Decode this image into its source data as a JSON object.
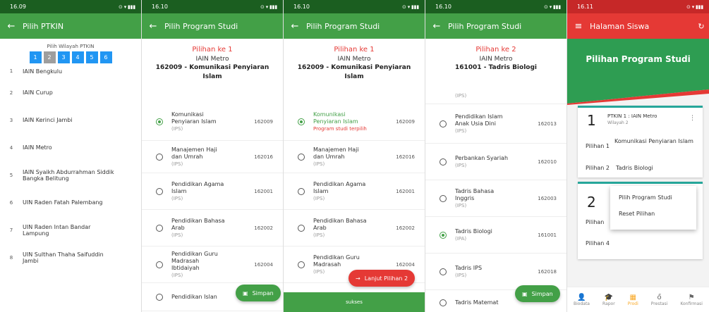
{
  "s1": {
    "time": "16.09",
    "title": "Pilih PTKIN",
    "wilayah_label": "Pilih Wilayah PTKIN",
    "pages": [
      "1",
      "2",
      "3",
      "4",
      "5",
      "6"
    ],
    "items": [
      {
        "n": "1",
        "name": "IAIN Bengkulu"
      },
      {
        "n": "2",
        "name": "IAIN Curup"
      },
      {
        "n": "3",
        "name": "IAIN Kerinci Jambi"
      },
      {
        "n": "4",
        "name": "IAIN Metro"
      },
      {
        "n": "5",
        "name": "IAIN Syaikh Abdurrahman Siddik Bangka Belitung"
      },
      {
        "n": "6",
        "name": "UIN Raden Fatah Palembang"
      },
      {
        "n": "7",
        "name": "UIN Raden Intan Bandar Lampung"
      },
      {
        "n": "8",
        "name": "UIN Sulthan Thaha Saifuddin Jambi"
      }
    ]
  },
  "s2": {
    "time": "16.10",
    "title": "Pilih Program Studi",
    "pilihan": "Pilihan ke 1",
    "campus": "IAIN Metro",
    "prodi": "162009 - Komunikasi Penyiaran Islam",
    "items": [
      {
        "name": "Komunikasi Penyiaran Islam",
        "type": "(IPS)",
        "code": "162009"
      },
      {
        "name": "Manajemen Haji dan Umrah",
        "type": "(IPS)",
        "code": "162016"
      },
      {
        "name": "Pendidikan Agama Islam",
        "type": "(IPS)",
        "code": "162001"
      },
      {
        "name": "Pendidikan Bahasa Arab",
        "type": "(IPS)",
        "code": "162002"
      },
      {
        "name": "Pendidikan Guru Madrasah Ibtidaiyah",
        "type": "(IPS)",
        "code": "162004"
      },
      {
        "name": "Pendidikan Islan",
        "type": "",
        "code": ""
      }
    ],
    "fab": "Simpan"
  },
  "s3": {
    "time": "16.10",
    "title": "Pilih Program Studi",
    "pilihan": "Pilihan ke 1",
    "campus": "IAIN Metro",
    "prodi": "162009 - Komunikasi Penyiaran Islam",
    "items": [
      {
        "name": "Komunikasi Penyiaran Islam",
        "type": "Program studi terpilih",
        "code": "162009"
      },
      {
        "name": "Manajemen Haji dan Umrah",
        "type": "(IPS)",
        "code": "162016"
      },
      {
        "name": "Pendidikan Agama Islam",
        "type": "(IPS)",
        "code": "162001"
      },
      {
        "name": "Pendidikan Bahasa Arab",
        "type": "(IPS)",
        "code": "162002"
      },
      {
        "name": "Pendidikan Guru Madrasah",
        "type": "(IPS)",
        "code": "162004"
      }
    ],
    "fab": "Lanjut Pilihan 2",
    "snackbar": "sukses"
  },
  "s4": {
    "time": "16.10",
    "title": "Pilih Program Studi",
    "pilihan": "Pilihan ke 2",
    "campus": "IAIN Metro",
    "prodi": "161001 - Tadris Biologi",
    "top_partial": "(IPS)",
    "items": [
      {
        "name": "Pendidikan Islam Anak Usia Dini",
        "type": "(IPS)",
        "code": "162013"
      },
      {
        "name": "Perbankan Syariah",
        "type": "(IPS)",
        "code": "162010"
      },
      {
        "name": "Tadris Bahasa Inggris",
        "type": "(IPS)",
        "code": "162003"
      },
      {
        "name": "Tadris Biologi",
        "type": "(IPA)",
        "code": "161001"
      },
      {
        "name": "Tadris IPS",
        "type": "(IPS)",
        "code": "162018"
      },
      {
        "name": "Tadris Matemat",
        "type": "",
        "code": ""
      }
    ],
    "fab": "Simpan"
  },
  "s5": {
    "time": "16.11",
    "title": "Halaman Siswa",
    "banner": "Pilihan Program Studi",
    "card1": {
      "num": "1",
      "title": "PTKIN 1 : IAIN Metro",
      "sub": "Wilayah 2",
      "p1_label": "Pilihan 1",
      "p1_value": "Komunikasi Penyiaran Islam",
      "p2_label": "Pilihan 2",
      "p2_value": "Tadris Biologi"
    },
    "card2": {
      "num": "2",
      "p3": "Pilihan",
      "p4": "Pilihan 4"
    },
    "menu": [
      "Pilih Program Studi",
      "Reset Pilihan"
    ],
    "nav": [
      "Biodata",
      "Rapor",
      "Prodi",
      "Prestasi",
      "Konfirmasi"
    ]
  },
  "colors": {
    "green": "#43a047",
    "dark_green": "#1b5e20",
    "red": "#e53935",
    "blue": "#2196f3"
  }
}
